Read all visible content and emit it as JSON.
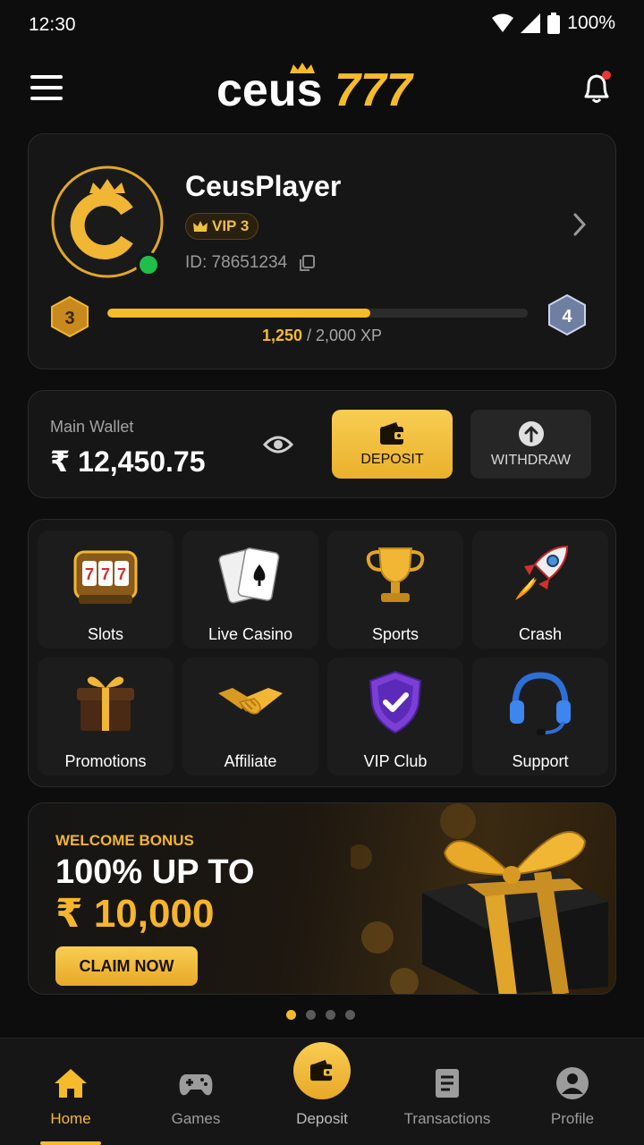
{
  "status_bar": {
    "time": "12:30",
    "battery": "100%"
  },
  "header": {
    "logo_text_a": "ceus",
    "logo_text_b": "777"
  },
  "profile": {
    "username": "CeusPlayer",
    "vip_label": "VIP 3",
    "id_label": "ID: 78651234",
    "current_level": "3",
    "next_level": "4",
    "xp_current": "1,250",
    "xp_rest": " / 2,000 XP",
    "xp_progress": 0.625
  },
  "wallet": {
    "label": "Main Wallet",
    "amount": "₹ 12,450.75",
    "deposit_label": "DEPOSIT",
    "withdraw_label": "WITHDRAW"
  },
  "games": [
    {
      "label": "Slots",
      "icon": "slot-machine-icon"
    },
    {
      "label": "Live Casino",
      "icon": "playing-cards-icon"
    },
    {
      "label": "Sports",
      "icon": "trophy-icon"
    },
    {
      "label": "Crash",
      "icon": "rocket-icon"
    },
    {
      "label": "Promotions",
      "icon": "gift-icon"
    },
    {
      "label": "Affiliate",
      "icon": "handshake-icon"
    },
    {
      "label": "VIP Club",
      "icon": "shield-check-icon"
    },
    {
      "label": "Support",
      "icon": "headset-icon"
    }
  ],
  "banner": {
    "kicker": "WELCOME BONUS",
    "headline": "100% UP TO",
    "amount": "₹ 10,000",
    "cta": "CLAIM NOW",
    "slides": 4,
    "active_slide": 1
  },
  "nav": {
    "home": "Home",
    "games": "Games",
    "deposit": "Deposit",
    "transactions": "Transactions",
    "profile": "Profile"
  },
  "colors": {
    "accent": "#f5bb2b",
    "background": "#0d0d0d",
    "card": "#161616",
    "online": "#1fbf4a"
  }
}
